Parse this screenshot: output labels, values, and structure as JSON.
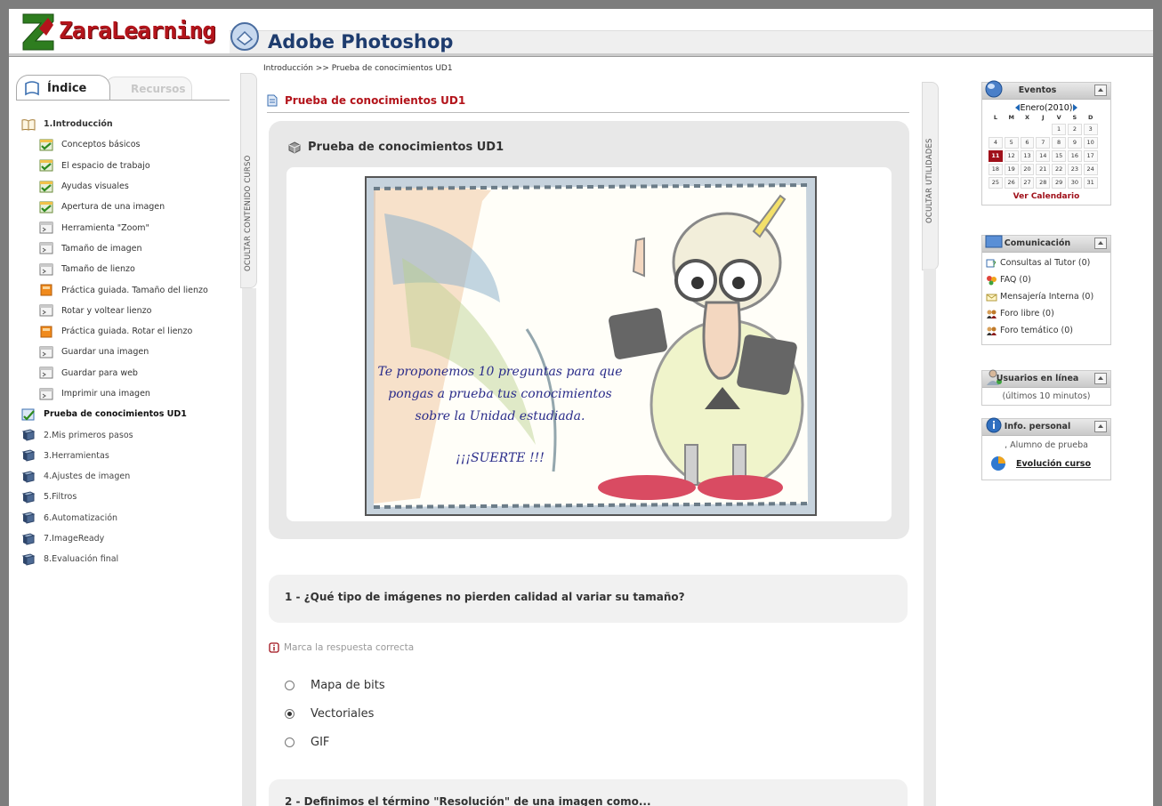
{
  "brand": {
    "name": "ZaraLearning",
    "course": "Adobe Photoshop"
  },
  "colors": {
    "brand_red": "#b3141b",
    "course_blue": "#1e3c6e"
  },
  "tabs": {
    "indice": "Índice",
    "recursos": "Recursos"
  },
  "sidebar": {
    "hide_label": "OCULTAR CONTENIDO CURSO",
    "tree": [
      {
        "label": "1.Introducción",
        "kind": "root",
        "icon": "open-book-icon"
      },
      {
        "label": "Conceptos básicos",
        "kind": "child",
        "icon": "green-check-page-icon"
      },
      {
        "label": "El espacio de trabajo",
        "kind": "child",
        "icon": "green-check-page-icon"
      },
      {
        "label": "Ayudas visuales",
        "kind": "child",
        "icon": "green-check-page-icon"
      },
      {
        "label": "Apertura de una imagen",
        "kind": "child",
        "icon": "green-check-page-icon"
      },
      {
        "label": "Herramienta \"Zoom\"",
        "kind": "child",
        "icon": "page-icon"
      },
      {
        "label": "Tamaño de imagen",
        "kind": "child",
        "icon": "page-icon"
      },
      {
        "label": "Tamaño de lienzo",
        "kind": "child",
        "icon": "page-icon"
      },
      {
        "label": "Práctica guiada. Tamaño del lienzo",
        "kind": "child",
        "icon": "practice-icon"
      },
      {
        "label": "Rotar y voltear lienzo",
        "kind": "child",
        "icon": "page-icon"
      },
      {
        "label": "Práctica guiada. Rotar el lienzo",
        "kind": "child",
        "icon": "practice-icon"
      },
      {
        "label": "Guardar una imagen",
        "kind": "child",
        "icon": "page-icon"
      },
      {
        "label": "Guardar para web",
        "kind": "child",
        "icon": "page-icon"
      },
      {
        "label": "Imprimir una imagen",
        "kind": "child",
        "icon": "page-icon"
      },
      {
        "label": "Prueba de conocimientos UD1",
        "kind": "current",
        "icon": "test-icon"
      },
      {
        "label": "2.Mis primeros pasos",
        "kind": "unit",
        "icon": "book-icon"
      },
      {
        "label": "3.Herramientas",
        "kind": "unit",
        "icon": "book-icon"
      },
      {
        "label": "4.Ajustes de imagen",
        "kind": "unit",
        "icon": "book-icon"
      },
      {
        "label": "5.Filtros",
        "kind": "unit",
        "icon": "book-icon"
      },
      {
        "label": "6.Automatización",
        "kind": "unit",
        "icon": "book-icon"
      },
      {
        "label": "7.ImageReady",
        "kind": "unit",
        "icon": "book-icon"
      },
      {
        "label": "8.Evaluación final",
        "kind": "unit",
        "icon": "book-icon"
      }
    ]
  },
  "main": {
    "breadcrumb": "Introducción >> Prueba de conocimientos UD1",
    "section_title": "Prueba de conocimientos UD1",
    "box_title": "Prueba de conocimientos UD1",
    "image_text": [
      "Te proponemos 10 preguntas para que",
      "pongas a prueba tus conocimientos",
      "sobre la Unidad estudiada.",
      "¡¡¡SUERTE !!!"
    ],
    "q1": "1 - ¿Qué tipo de imágenes no pierden calidad al variar su tamaño?",
    "hint": "Marca la respuesta correcta",
    "options": [
      {
        "label": "Mapa de bits",
        "selected": false
      },
      {
        "label": "Vectoriales",
        "selected": true
      },
      {
        "label": "GIF",
        "selected": false
      }
    ],
    "q2": "2 - Definimos el término \"Resolución\" de una imagen como..."
  },
  "right": {
    "hide_label": "OCULTAR UTILIDADES",
    "events": {
      "title": "Eventos",
      "month": "Enero(2010)",
      "weekdays": [
        "L",
        "M",
        "X",
        "J",
        "V",
        "S",
        "D"
      ],
      "days": [
        "",
        "",
        "",
        "",
        "1",
        "2",
        "3",
        "4",
        "5",
        "6",
        "7",
        "8",
        "9",
        "10",
        "11",
        "12",
        "13",
        "14",
        "15",
        "16",
        "17",
        "18",
        "19",
        "20",
        "21",
        "22",
        "23",
        "24",
        "25",
        "26",
        "27",
        "28",
        "29",
        "30",
        "31"
      ],
      "today": "11",
      "link": "Ver Calendario"
    },
    "comm": {
      "title": "Comunicación",
      "items": [
        {
          "label": "Consultas al Tutor (0)",
          "icon": "tutor-icon"
        },
        {
          "label": "FAQ (0)",
          "icon": "faq-icon"
        },
        {
          "label": "Mensajería Interna (0)",
          "icon": "mail-icon"
        },
        {
          "label": "Foro libre (0)",
          "icon": "forum-icon"
        },
        {
          "label": "Foro temático (0)",
          "icon": "forum-icon"
        }
      ]
    },
    "online": {
      "title": "Usuarios en línea",
      "text": "(últimos 10 minutos)"
    },
    "personal": {
      "title": "Info. personal",
      "user": ", Alumno de prueba",
      "link": "Evolución curso"
    }
  }
}
